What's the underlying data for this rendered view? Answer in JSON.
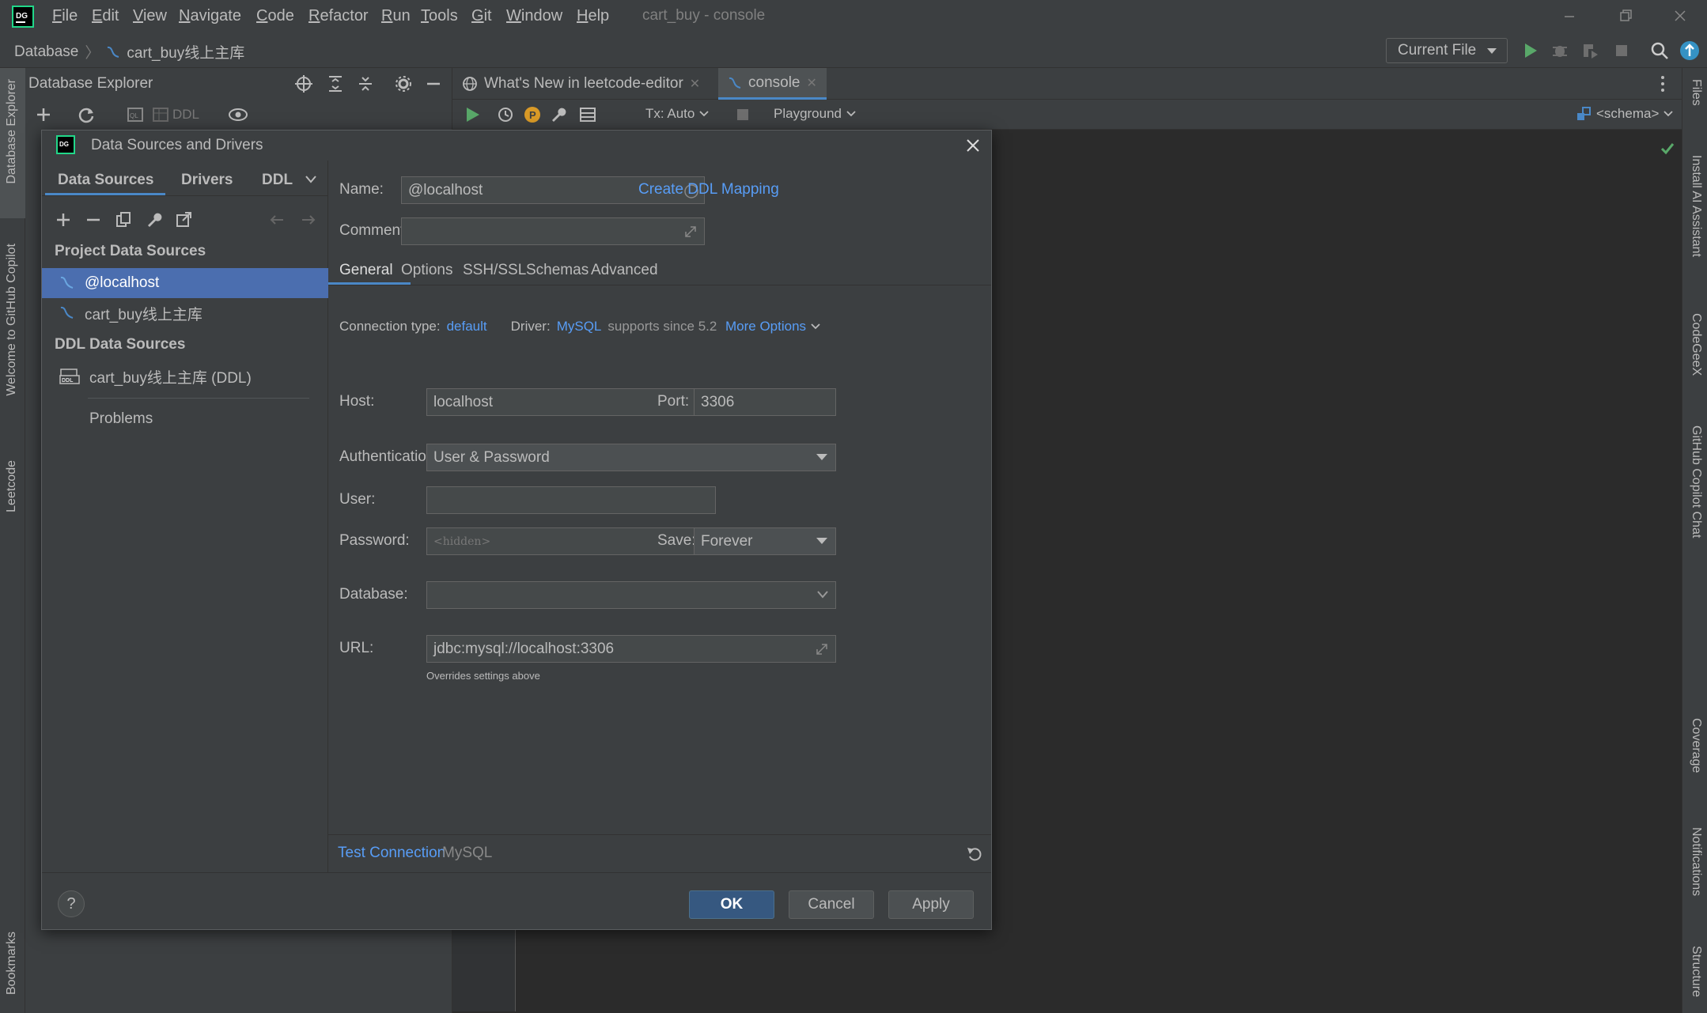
{
  "app": {
    "window_title": "cart_buy - console",
    "menu": [
      {
        "pre": "",
        "u": "F",
        "post": "ile"
      },
      {
        "pre": "",
        "u": "E",
        "post": "dit"
      },
      {
        "pre": "",
        "u": "V",
        "post": "iew"
      },
      {
        "pre": "",
        "u": "N",
        "post": "avigate"
      },
      {
        "pre": "",
        "u": "C",
        "post": "ode"
      },
      {
        "pre": "",
        "u": "R",
        "post": "efactor"
      },
      {
        "pre": "",
        "u": "R",
        "post": "un"
      },
      {
        "pre": "",
        "u": "T",
        "post": "ools"
      },
      {
        "pre": "",
        "u": "G",
        "post": "it"
      },
      {
        "pre": "",
        "u": "W",
        "post": "indow"
      },
      {
        "pre": "",
        "u": "H",
        "post": "elp"
      }
    ]
  },
  "navbar": {
    "crumb_root": "Database",
    "crumb_leaf": "cart_buy线上主库",
    "run_config": "Current File"
  },
  "left_stripe": {
    "database_explorer": "Database Explorer",
    "welcome_copilot": "Welcome to GitHub Copilot",
    "leetcode": "Leetcode",
    "bookmarks": "Bookmarks"
  },
  "right_stripe": {
    "files": "Files",
    "ai_assistant": "Install AI Assistant",
    "codegeex": "CodeGeeX",
    "copilot_chat": "GitHub Copilot Chat",
    "coverage": "Coverage",
    "notifications": "Notifications",
    "structure": "Structure"
  },
  "db_explorer": {
    "title": "Database Explorer",
    "ddl_label": "DDL"
  },
  "editor": {
    "tabs": [
      {
        "label": "What's New in leetcode-editor"
      },
      {
        "label": "console"
      }
    ],
    "tx_label": "Tx: Auto",
    "playground_label": "Playground",
    "schema_label": "<schema>"
  },
  "dialog": {
    "title": "Data Sources and Drivers",
    "left_tabs": {
      "data_sources": "Data Sources",
      "drivers": "Drivers",
      "ddl": "DDL"
    },
    "project_section": "Project Data Sources",
    "project_items": [
      {
        "label": "@localhost",
        "selected": true
      },
      {
        "label": "cart_buy线上主库",
        "selected": false
      }
    ],
    "ddl_section": "DDL Data Sources",
    "ddl_items": [
      {
        "label": "cart_buy线上主库 (DDL)"
      }
    ],
    "problems": "Problems",
    "name_label": "Name:",
    "name_value": "@localhost",
    "comment_label": "Comment:",
    "comment_value": "",
    "create_ddl_mapping": "Create DDL Mapping",
    "tabs": [
      "General",
      "Options",
      "SSH/SSL",
      "Schemas",
      "Advanced"
    ],
    "connection_type_label": "Connection type:",
    "connection_type_value": "default",
    "driver_label": "Driver:",
    "driver_value": "MySQL",
    "driver_note": "supports since 5.2",
    "more_options": "More Options",
    "host_label": "Host:",
    "host_value": "localhost",
    "port_label": "Port:",
    "port_value": "3306",
    "auth_label": "Authentication:",
    "auth_value": "User & Password",
    "user_label": "User:",
    "user_value": "",
    "password_label": "Password:",
    "password_placeholder": "<hidden>",
    "save_label": "Save:",
    "save_value": "Forever",
    "database_label": "Database:",
    "database_value": "",
    "url_label": "URL:",
    "url_value": "jdbc:mysql://localhost:3306",
    "url_hint": "Overrides settings above",
    "test_connection": "Test Connection",
    "driver_footer": "MySQL",
    "ok": "OK",
    "cancel": "Cancel",
    "apply": "Apply",
    "help": "?"
  },
  "colors": {
    "accent": "#4a88c7",
    "link": "#589df6",
    "selection": "#4b6eaf",
    "run_green": "#59a869"
  }
}
